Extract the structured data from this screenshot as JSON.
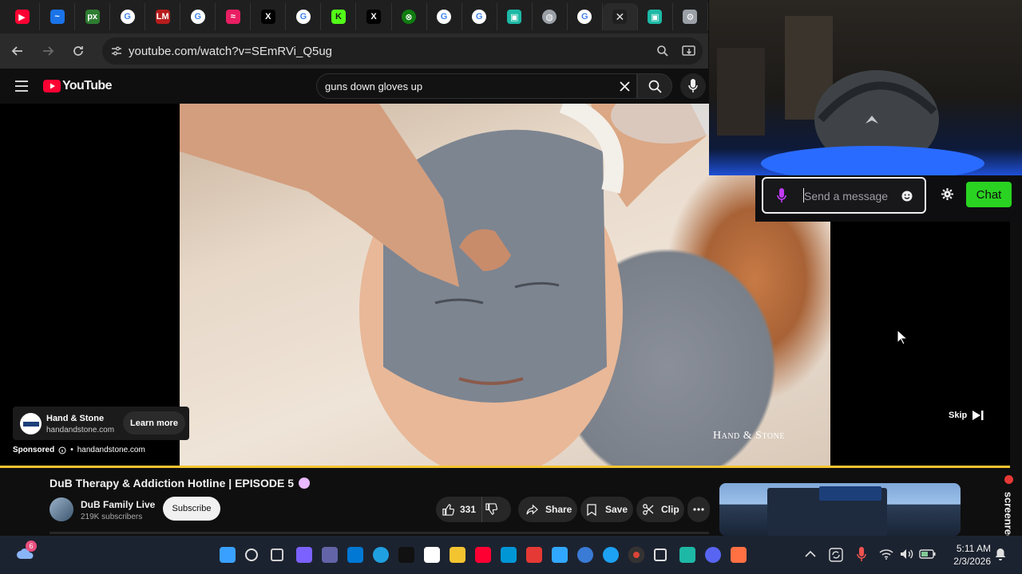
{
  "browser": {
    "url": "youtube.com/watch?v=SEmRVi_Q5ug",
    "tabs": [
      {
        "icon": "youtube-icon",
        "color": "#ff0033",
        "glyph": "▶"
      },
      {
        "icon": "blue-circle-icon",
        "color": "#1a73e8",
        "glyph": "~"
      },
      {
        "icon": "px-icon",
        "color": "#2e7d32",
        "glyph": "px"
      },
      {
        "icon": "google-icon",
        "color": "#ffffff",
        "glyph": "G"
      },
      {
        "icon": "lm-icon",
        "color": "#b71c1c",
        "glyph": "LM"
      },
      {
        "icon": "google-icon",
        "color": "#ffffff",
        "glyph": "G"
      },
      {
        "icon": "pink-wave-icon",
        "color": "#e91e63",
        "glyph": "≈"
      },
      {
        "icon": "x-icon",
        "color": "#000000",
        "glyph": "X"
      },
      {
        "icon": "google-icon",
        "color": "#ffffff",
        "glyph": "G"
      },
      {
        "icon": "kick-icon",
        "color": "#53fc18",
        "glyph": "K"
      },
      {
        "icon": "x-icon",
        "color": "#000000",
        "glyph": "X"
      },
      {
        "icon": "xbox-icon",
        "color": "#107c10",
        "glyph": "⊗"
      },
      {
        "icon": "google-icon",
        "color": "#ffffff",
        "glyph": "G"
      },
      {
        "icon": "google-icon",
        "color": "#ffffff",
        "glyph": "G"
      },
      {
        "icon": "teal-app-icon",
        "color": "#1db9a6",
        "glyph": "▣"
      },
      {
        "icon": "globe-icon",
        "color": "#9aa0a6",
        "glyph": "◍"
      },
      {
        "icon": "google-icon",
        "color": "#ffffff",
        "glyph": "G"
      },
      {
        "icon": "close-tab-icon",
        "color": "#1f1f1f",
        "glyph": "✕"
      },
      {
        "icon": "teal-app-icon",
        "color": "#1db9a6",
        "glyph": "▣"
      },
      {
        "icon": "gear-icon",
        "color": "#9aa0a6",
        "glyph": "⚙"
      }
    ]
  },
  "youtube": {
    "logo_text": "YouTube",
    "search_query": "guns down gloves up"
  },
  "ad": {
    "advertiser": "Hand & Stone",
    "domain": "handandstone.com",
    "learn_more": "Learn more",
    "sponsored": "Sponsored",
    "sponsored_domain": "handandstone.com",
    "skip": "Skip",
    "watermark": "Hand & Stone"
  },
  "stream_chat": {
    "placeholder": "Send a message",
    "chat_button": "Chat"
  },
  "video": {
    "title": "DuB Therapy & Addiction Hotline | EPISODE 5",
    "channel": "DuB Family Live",
    "subscribers": "219K subscribers",
    "subscribe": "Subscribe",
    "likes": "331",
    "share": "Share",
    "save": "Save",
    "clip": "Clip"
  },
  "recorder": {
    "label": "screenrec"
  },
  "taskbar": {
    "weather_badge": "6",
    "time": "5:11 AM",
    "date": "2/3/2026"
  }
}
